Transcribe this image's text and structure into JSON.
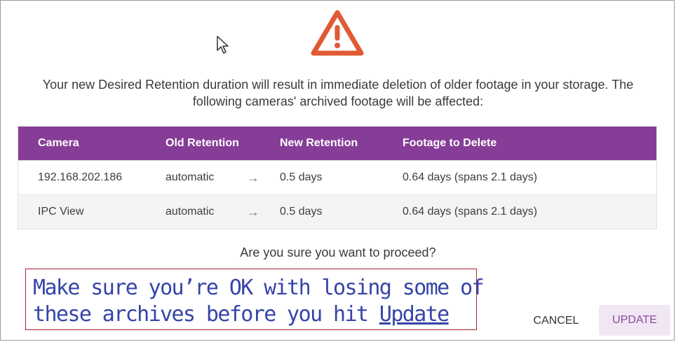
{
  "dialog": {
    "icons": {
      "warning": "warning-triangle-icon",
      "cursor": "mouse-pointer-icon",
      "arrow": "→"
    },
    "message_line1": "Your new Desired Retention duration will result in immediate deletion of older footage in your storage. The",
    "message_line2": "following cameras' archived footage will be affected:",
    "table": {
      "headers": [
        "Camera",
        "Old Retention",
        "New Retention",
        "Footage to Delete"
      ],
      "rows": [
        {
          "camera": "192.168.202.186",
          "old": "automatic",
          "new": "0.5 days",
          "delete": "0.64 days (spans 2.1 days)"
        },
        {
          "camera": "IPC View",
          "old": "automatic",
          "new": "0.5 days",
          "delete": "0.64 days (spans 2.1 days)"
        }
      ]
    },
    "proceed": "Are you sure you want to proceed?",
    "buttons": {
      "cancel": "CANCEL",
      "update": "UPDATE"
    }
  },
  "callout": {
    "line1": "Make sure you’re OK with losing some of",
    "line2_prefix": "these archives before you hit ",
    "line2_link": "Update"
  },
  "colors": {
    "header_bg": "#863d97",
    "warning": "#e05a33",
    "callout_text": "#3545a8",
    "callout_border": "#b21d2f",
    "update_bg": "#f1e6f4"
  }
}
